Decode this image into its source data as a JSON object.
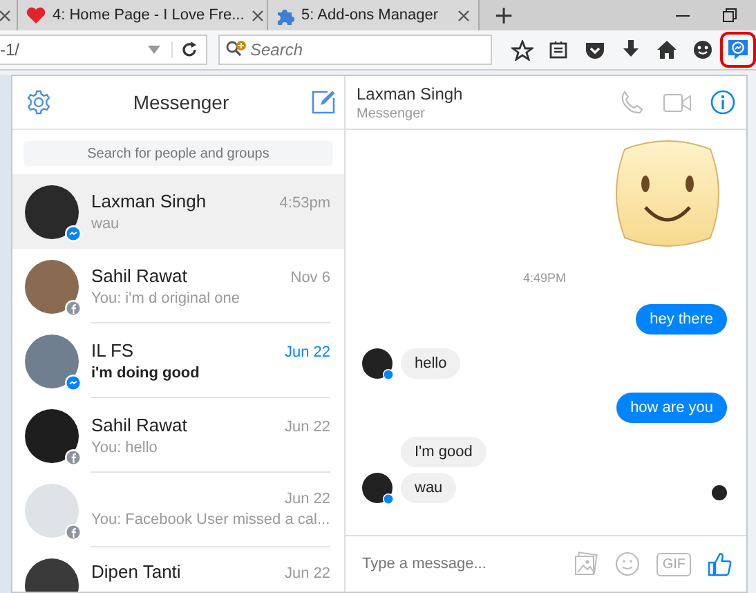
{
  "browser": {
    "tabs": [
      {
        "kind": "partial"
      },
      {
        "kind": "heart",
        "title": "4: Home Page - I Love Fre..."
      },
      {
        "kind": "puzzle",
        "title": "5: Add-ons Manager"
      }
    ],
    "new_tab": "+",
    "address": {
      "value": "-1/"
    },
    "search": {
      "placeholder": "Search"
    },
    "toolbar_icons": [
      {
        "kind": "star",
        "active": false
      },
      {
        "kind": "list",
        "active": false
      },
      {
        "kind": "pocket",
        "active": false
      },
      {
        "kind": "download",
        "active": false
      },
      {
        "kind": "home",
        "active": false
      },
      {
        "kind": "smiley",
        "active": false
      },
      {
        "kind": "messenger",
        "active": true
      }
    ]
  },
  "sidebar": {
    "title": "Messenger",
    "search": {
      "placeholder": "Search for people and groups"
    },
    "conversations": [
      {
        "kind": "messenger",
        "name": "Laxman Singh",
        "time": "4:53pm",
        "preview": "wau",
        "unread": false,
        "selected": true,
        "color": "#2a2a2a"
      },
      {
        "kind": "facebook",
        "name": "Sahil Rawat",
        "time": "Nov 6",
        "preview": "You: i'm d original one",
        "unread": false,
        "selected": false,
        "color": "#8a6a50"
      },
      {
        "kind": "messenger",
        "name": "IL FS",
        "time": "Jun 22",
        "preview": "i'm doing good",
        "unread": true,
        "selected": false,
        "color": "#6f7f90"
      },
      {
        "kind": "facebook",
        "name": "Sahil Rawat",
        "time": "Jun 22",
        "preview": "You: hello",
        "unread": false,
        "selected": false,
        "color": "#1e1e1e"
      },
      {
        "kind": "facebook",
        "time": "Jun 22",
        "preview": "You: Facebook User missed a cal...",
        "unread": false,
        "selected": false,
        "color": "#dfe3e8"
      },
      {
        "kind": "plain",
        "name": "Dipen Tanti",
        "time": "Jun 22",
        "unread": false,
        "selected": false,
        "color": "#3a3a3a"
      }
    ]
  },
  "chat": {
    "name": "Laxman Singh",
    "subtitle": "Messenger",
    "items": [
      {
        "kind": "sticker"
      },
      {
        "kind": "time",
        "text": "4:49PM"
      },
      {
        "kind": "sent",
        "text": "hey there"
      },
      {
        "kind": "received",
        "text": "hello",
        "avatar": true
      },
      {
        "kind": "sent",
        "text": "how are you"
      },
      {
        "kind": "received",
        "text": "I'm good",
        "avatar": false
      },
      {
        "kind": "received",
        "text": "wau",
        "avatar": true,
        "seen": true
      }
    ],
    "composer": {
      "placeholder": "Type a message...",
      "gif": "GIF"
    }
  }
}
